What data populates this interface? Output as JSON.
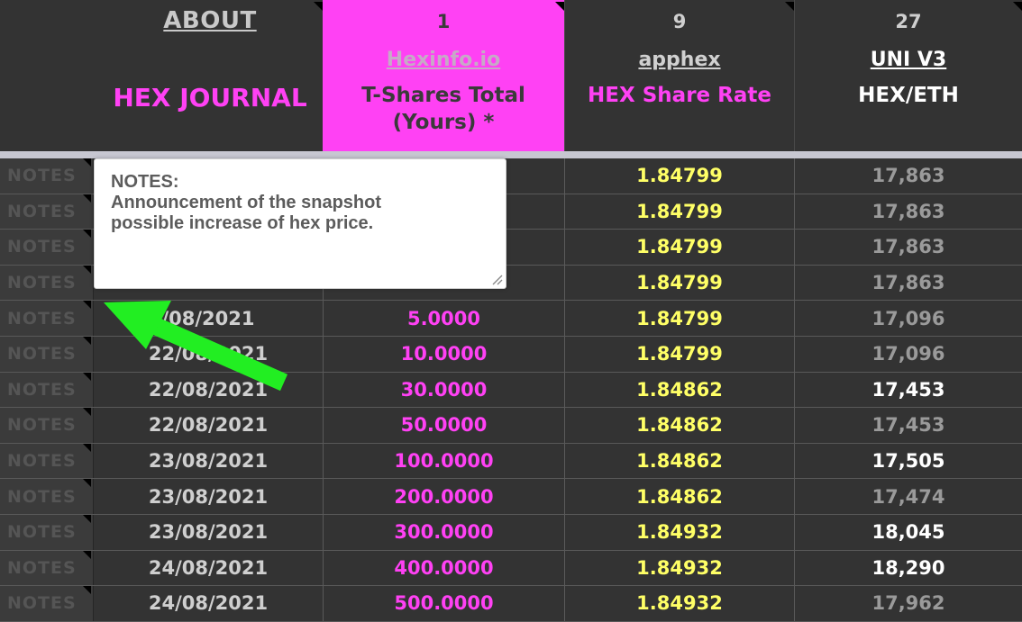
{
  "header": {
    "about_label": "ABOUT",
    "journal_title": "HEX JOURNAL",
    "columns": [
      {
        "number": "1",
        "link": "Hexinfo.io",
        "title_line1": "T-Shares Total",
        "title_line2": "(Yours) *"
      },
      {
        "number": "9",
        "link": "apphex",
        "title_line1": "HEX Share Rate",
        "title_line2": ""
      },
      {
        "number": "27",
        "link": "UNI V3",
        "title_line1": "HEX/ETH",
        "title_line2": ""
      }
    ]
  },
  "notes_label": "NOTES",
  "popup": {
    "title": "NOTES:",
    "line1": "Announcement of the snapshot",
    "line2": "possible increase of hex price."
  },
  "rows": [
    {
      "date": "",
      "shares": "",
      "rate": "1.84799",
      "hex_eth": "17,863",
      "eth_bright": false
    },
    {
      "date": "",
      "shares": "",
      "rate": "1.84799",
      "hex_eth": "17,863",
      "eth_bright": false
    },
    {
      "date": "",
      "shares": "",
      "rate": "1.84799",
      "hex_eth": "17,863",
      "eth_bright": false
    },
    {
      "date": "",
      "shares": "",
      "rate": "1.84799",
      "hex_eth": "17,863",
      "eth_bright": false
    },
    {
      "date": "/08/2021",
      "shares": "5.0000",
      "rate": "1.84799",
      "hex_eth": "17,096",
      "eth_bright": false
    },
    {
      "date": "22/08/2021",
      "shares": "10.0000",
      "rate": "1.84799",
      "hex_eth": "17,096",
      "eth_bright": false
    },
    {
      "date": "22/08/2021",
      "shares": "30.0000",
      "rate": "1.84862",
      "hex_eth": "17,453",
      "eth_bright": true
    },
    {
      "date": "22/08/2021",
      "shares": "50.0000",
      "rate": "1.84862",
      "hex_eth": "17,453",
      "eth_bright": false
    },
    {
      "date": "23/08/2021",
      "shares": "100.0000",
      "rate": "1.84862",
      "hex_eth": "17,505",
      "eth_bright": true
    },
    {
      "date": "23/08/2021",
      "shares": "200.0000",
      "rate": "1.84862",
      "hex_eth": "17,474",
      "eth_bright": false
    },
    {
      "date": "23/08/2021",
      "shares": "300.0000",
      "rate": "1.84932",
      "hex_eth": "18,045",
      "eth_bright": true
    },
    {
      "date": "24/08/2021",
      "shares": "400.0000",
      "rate": "1.84932",
      "hex_eth": "18,290",
      "eth_bright": true
    },
    {
      "date": "24/08/2021",
      "shares": "500.0000",
      "rate": "1.84932",
      "hex_eth": "17,962",
      "eth_bright": false
    }
  ],
  "colors": {
    "accent_magenta": "#ff41f4",
    "rate_yellow": "#ffff66",
    "arrow_green": "#22ee22",
    "background": "#333333"
  },
  "icons": {
    "arrow": "green-arrow-icon",
    "note_marker": "comment-indicator-icon",
    "resize": "resize-grip-icon"
  }
}
